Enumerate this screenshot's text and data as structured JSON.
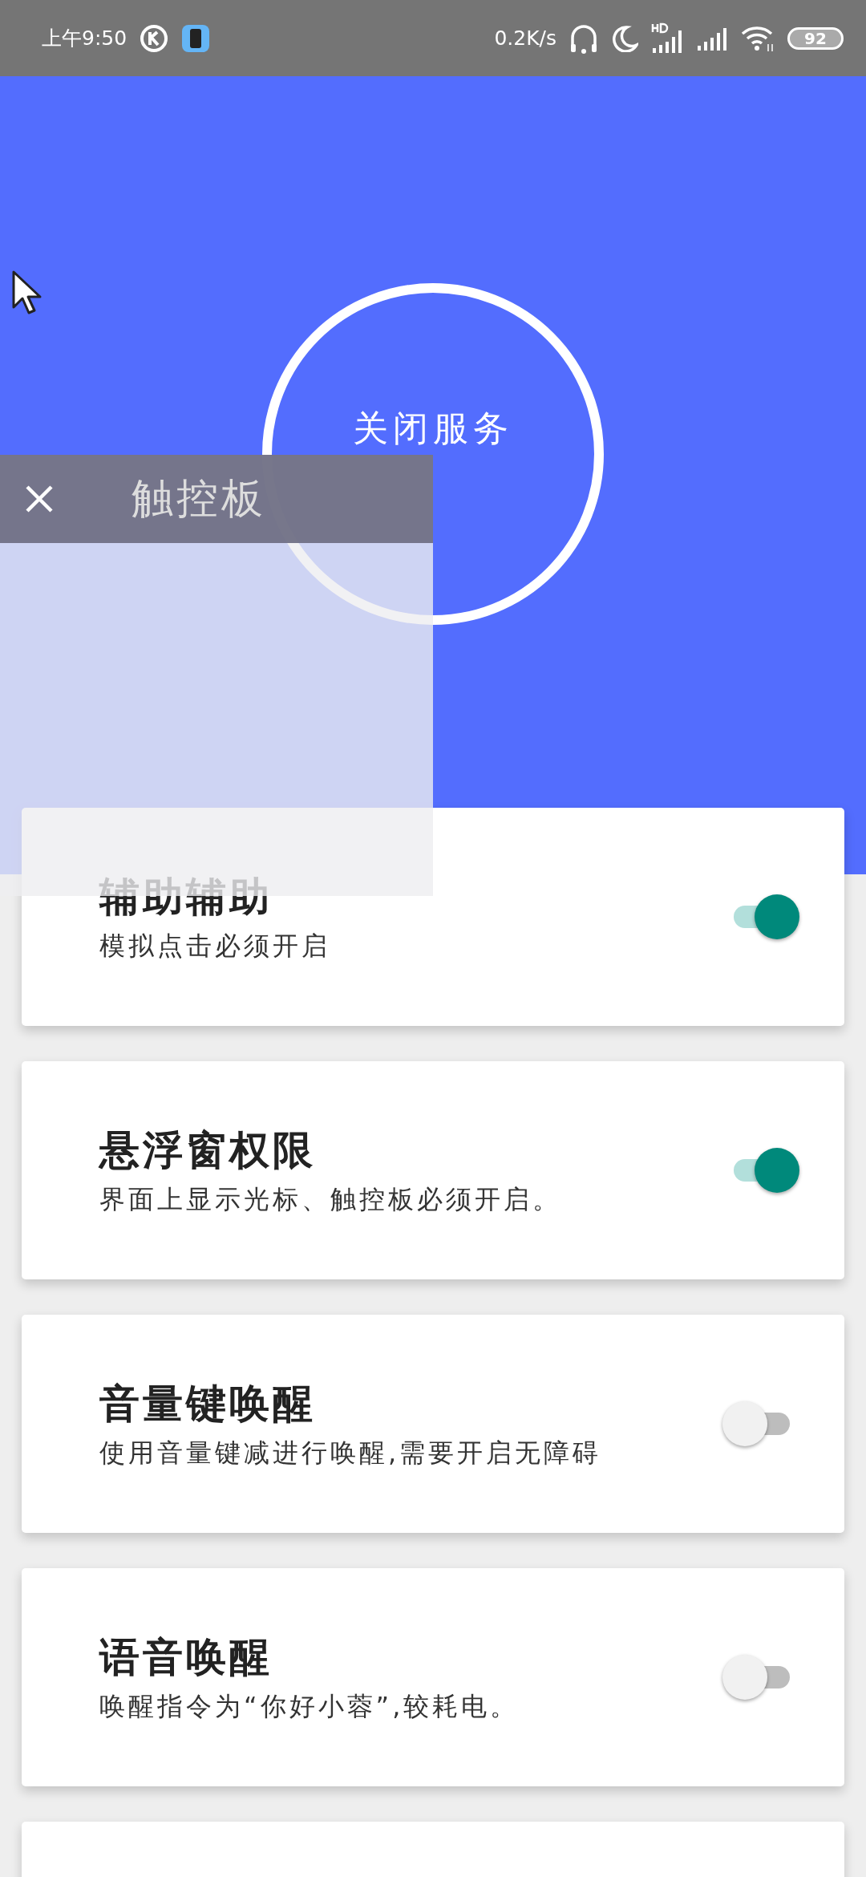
{
  "status_bar": {
    "time": "上午9:50",
    "network_speed": "0.2K/s",
    "battery": "92"
  },
  "header": {
    "button": "关闭服务"
  },
  "touchpad": {
    "title": "触控板"
  },
  "settings": [
    {
      "title": "辅助辅助",
      "subtitle": "模拟点击必须开启",
      "on": true
    },
    {
      "title": "悬浮窗权限",
      "subtitle": "界面上显示光标、触控板必须开启。",
      "on": true
    },
    {
      "title": "音量键唤醒",
      "subtitle": "使用音量键减进行唤醒,需要开启无障碍",
      "on": false
    },
    {
      "title": "语音唤醒",
      "subtitle": "唤醒指令为“你好小蓉”,较耗电。",
      "on": false
    }
  ]
}
